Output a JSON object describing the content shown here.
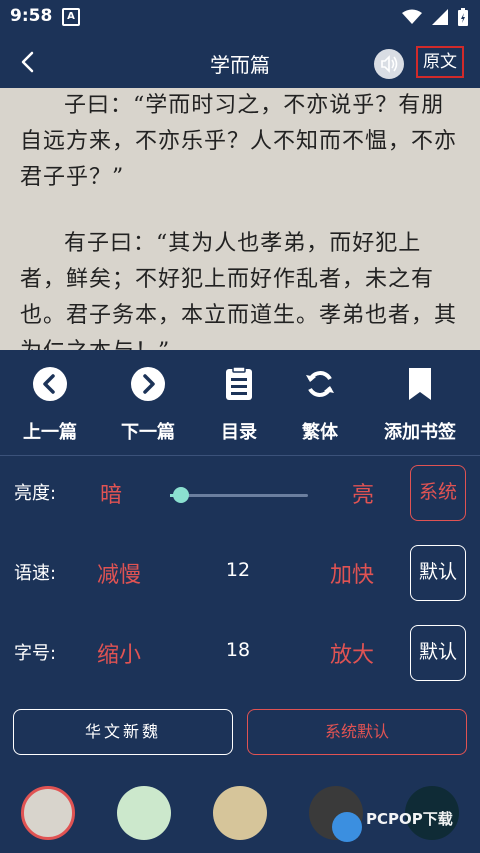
{
  "status_bar": {
    "time": "9:58",
    "notification_icon": "A",
    "icons": [
      "wifi-icon",
      "signal-icon",
      "battery-charging-icon"
    ]
  },
  "header": {
    "title": "学而篇",
    "back_icon": "chevron-left-icon",
    "speaker_icon": "speaker-icon",
    "original_text_label": "原文"
  },
  "reader": {
    "background": "#d8d4cc",
    "paragraphs": [
      "子曰：“学而时习之，不亦说乎？有朋自远方来，不亦乐乎？人不知而不愠，不亦君子乎？”",
      "有子曰：“其为人也孝弟，而好犯上者，鲜矣；不好犯上而好作乱者，未之有也。君子务本，本立而道生。孝弟也者，其为仁之本与！”"
    ]
  },
  "toolbar": {
    "items": [
      {
        "label": "上一篇",
        "icon": "circle-chevron-left-icon"
      },
      {
        "label": "下一篇",
        "icon": "circle-chevron-right-icon"
      },
      {
        "label": "目录",
        "icon": "document-list-icon"
      },
      {
        "label": "繁体",
        "icon": "refresh-icon"
      },
      {
        "label": "添加书签",
        "icon": "bookmark-icon"
      }
    ]
  },
  "settings": {
    "brightness": {
      "label": "亮度:",
      "dark": "暗",
      "bright": "亮",
      "level": 0.08,
      "button": "系统"
    },
    "speed": {
      "label": "语速:",
      "decrease": "减慢",
      "value": "12",
      "increase": "加快",
      "button": "默认"
    },
    "font_size": {
      "label": "字号:",
      "decrease": "缩小",
      "value": "18",
      "increase": "放大",
      "button": "默认"
    }
  },
  "fonts": {
    "option1": "华文新魏",
    "option2": "系统默认"
  },
  "themes": {
    "colors": [
      "#d8d4cc",
      "#cce8cc",
      "#d6c59a",
      "#3a3a3a",
      "#0f2b36"
    ],
    "selected_index": 0
  },
  "watermark": "PCPOP下载",
  "colors": {
    "accent": "#e05353",
    "background": "#1c3358",
    "slider": "#8be0d0"
  }
}
